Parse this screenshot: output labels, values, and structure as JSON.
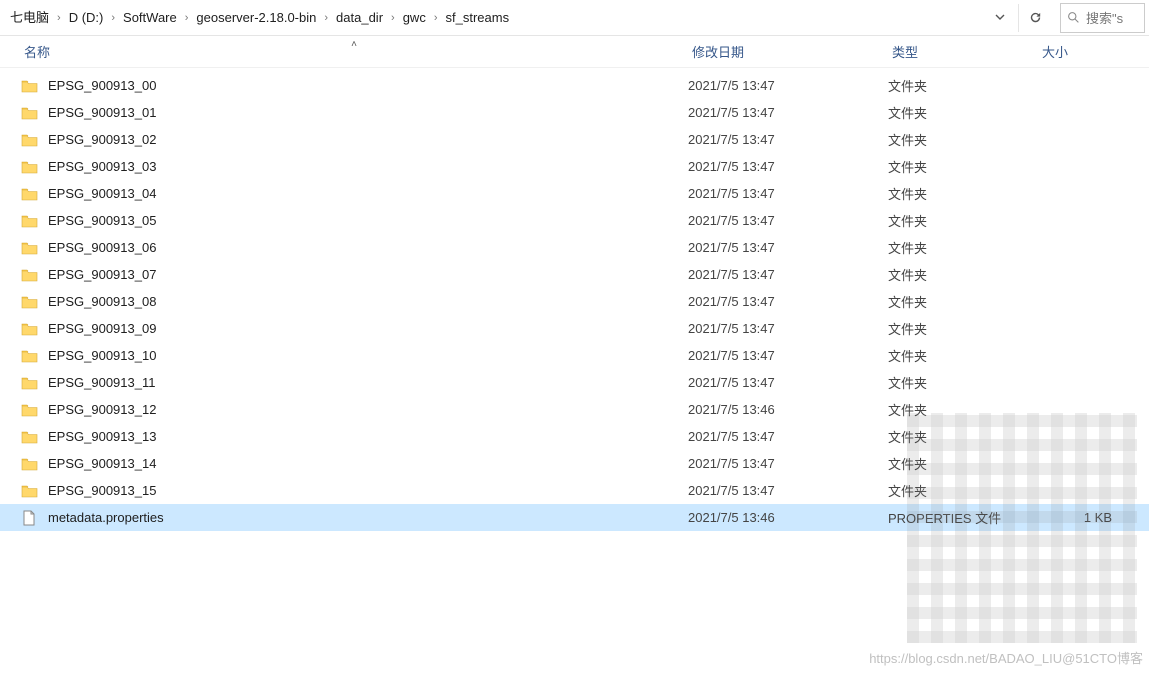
{
  "breadcrumbs": [
    "七电脑",
    "D (D:)",
    "SoftWare",
    "geoserver-2.18.0-bin",
    "data_dir",
    "gwc",
    "sf_streams"
  ],
  "search_prefix": "搜索\"s",
  "columns": {
    "name": "名称",
    "date": "修改日期",
    "type": "类型",
    "size": "大小"
  },
  "rows": [
    {
      "icon": "folder",
      "name": "EPSG_900913_00",
      "date": "2021/7/5 13:47",
      "type": "文件夹",
      "size": ""
    },
    {
      "icon": "folder",
      "name": "EPSG_900913_01",
      "date": "2021/7/5 13:47",
      "type": "文件夹",
      "size": ""
    },
    {
      "icon": "folder",
      "name": "EPSG_900913_02",
      "date": "2021/7/5 13:47",
      "type": "文件夹",
      "size": ""
    },
    {
      "icon": "folder",
      "name": "EPSG_900913_03",
      "date": "2021/7/5 13:47",
      "type": "文件夹",
      "size": ""
    },
    {
      "icon": "folder",
      "name": "EPSG_900913_04",
      "date": "2021/7/5 13:47",
      "type": "文件夹",
      "size": ""
    },
    {
      "icon": "folder",
      "name": "EPSG_900913_05",
      "date": "2021/7/5 13:47",
      "type": "文件夹",
      "size": ""
    },
    {
      "icon": "folder",
      "name": "EPSG_900913_06",
      "date": "2021/7/5 13:47",
      "type": "文件夹",
      "size": ""
    },
    {
      "icon": "folder",
      "name": "EPSG_900913_07",
      "date": "2021/7/5 13:47",
      "type": "文件夹",
      "size": ""
    },
    {
      "icon": "folder",
      "name": "EPSG_900913_08",
      "date": "2021/7/5 13:47",
      "type": "文件夹",
      "size": ""
    },
    {
      "icon": "folder",
      "name": "EPSG_900913_09",
      "date": "2021/7/5 13:47",
      "type": "文件夹",
      "size": ""
    },
    {
      "icon": "folder",
      "name": "EPSG_900913_10",
      "date": "2021/7/5 13:47",
      "type": "文件夹",
      "size": ""
    },
    {
      "icon": "folder",
      "name": "EPSG_900913_11",
      "date": "2021/7/5 13:47",
      "type": "文件夹",
      "size": ""
    },
    {
      "icon": "folder",
      "name": "EPSG_900913_12",
      "date": "2021/7/5 13:46",
      "type": "文件夹",
      "size": ""
    },
    {
      "icon": "folder",
      "name": "EPSG_900913_13",
      "date": "2021/7/5 13:47",
      "type": "文件夹",
      "size": ""
    },
    {
      "icon": "folder",
      "name": "EPSG_900913_14",
      "date": "2021/7/5 13:47",
      "type": "文件夹",
      "size": ""
    },
    {
      "icon": "folder",
      "name": "EPSG_900913_15",
      "date": "2021/7/5 13:47",
      "type": "文件夹",
      "size": ""
    },
    {
      "icon": "file",
      "name": "metadata.properties",
      "date": "2021/7/5 13:46",
      "type": "PROPERTIES 文件",
      "size": "1 KB",
      "selected": true
    }
  ],
  "watermark": "https://blog.csdn.net/BADAO_LIU@51CTO博客"
}
